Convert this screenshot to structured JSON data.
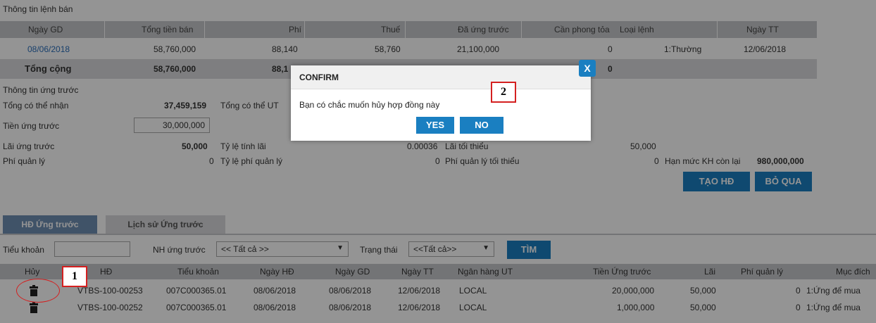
{
  "order_info": {
    "title": "Thông tin lệnh bán",
    "headers": [
      "Ngày GD",
      "Tổng tiền bán",
      "Phí",
      "Thuế",
      "Đã ứng trước",
      "Cần phong tỏa",
      "Loại lệnh",
      "Ngày TT"
    ],
    "row": [
      "08/06/2018",
      "58,760,000",
      "88,140",
      "58,760",
      "21,100,000",
      "0",
      "1:Thường",
      "12/06/2018"
    ],
    "total": {
      "label": "Tổng cộng",
      "amount": "58,760,000",
      "fee": "88,1",
      "blocked": "0"
    }
  },
  "advance_info": {
    "title": "Thông tin ứng trước",
    "total_receivable_label": "Tổng có thể nhận",
    "total_receivable_value": "37,459,159",
    "total_ut_label": "Tổng có thể UT",
    "advance_amount_label": "Tiền ứng trước",
    "advance_amount_value": "30,000,000",
    "interest_label": "Lãi ứng trước",
    "interest_value": "50,000",
    "rate_label": "Tỷ lệ tính lãi",
    "rate_value": "0.00036",
    "min_interest_label": "Lãi tối thiểu",
    "min_interest_value": "50,000",
    "mgmt_fee_label": "Phí quản lý",
    "mgmt_fee_value": "0",
    "mgmt_rate_label": "Tỷ lệ phí quản lý",
    "mgmt_rate_value": "0",
    "min_mgmt_fee_label": "Phí quản lý tối thiểu",
    "min_mgmt_fee_value": "0",
    "limit_label": "Hạn mức KH còn lại",
    "limit_value": "980,000,000"
  },
  "buttons": {
    "create": "TẠO HĐ",
    "skip": "BỎ QUA",
    "search": "TÌM"
  },
  "tabs": {
    "active": "HĐ Ứng trước",
    "history": "Lịch sử Ứng trước"
  },
  "filters": {
    "sub_account_label": "Tiểu khoản",
    "bank_label": "NH ứng trước",
    "bank_value": "<< Tất cả >>",
    "status_label": "Trạng thái",
    "status_value": "<<Tất cả>>"
  },
  "table": {
    "headers": [
      "Hủy",
      "HĐ",
      "Tiểu khoản",
      "Ngày HĐ",
      "Ngày GD",
      "Ngày TT",
      "Ngân hàng UT",
      "Tiền Ứng trước",
      "Lãi",
      "Phí quản lý",
      "Mục đích"
    ],
    "rows": [
      [
        "VTBS-100-00253",
        "007C000365.01",
        "08/06/2018",
        "08/06/2018",
        "12/06/2018",
        "LOCAL",
        "20,000,000",
        "50,000",
        "0",
        "1:Ứng để mua"
      ],
      [
        "VTBS-100-00252",
        "007C000365.01",
        "08/06/2018",
        "08/06/2018",
        "12/06/2018",
        "LOCAL",
        "1,000,000",
        "50,000",
        "0",
        "1:Ứng để mua"
      ]
    ]
  },
  "dialog": {
    "title": "CONFIRM",
    "close": "X",
    "message": "Bạn có chắc muốn hủy hợp đồng này",
    "yes": "YES",
    "no": "NO"
  },
  "callouts": {
    "one": "1",
    "two": "2"
  },
  "icons": {
    "delete": "trash-icon"
  },
  "colors": {
    "accent": "#1a7fc1",
    "callout_border": "#d42020",
    "header_bg": "#c7c9cc"
  }
}
